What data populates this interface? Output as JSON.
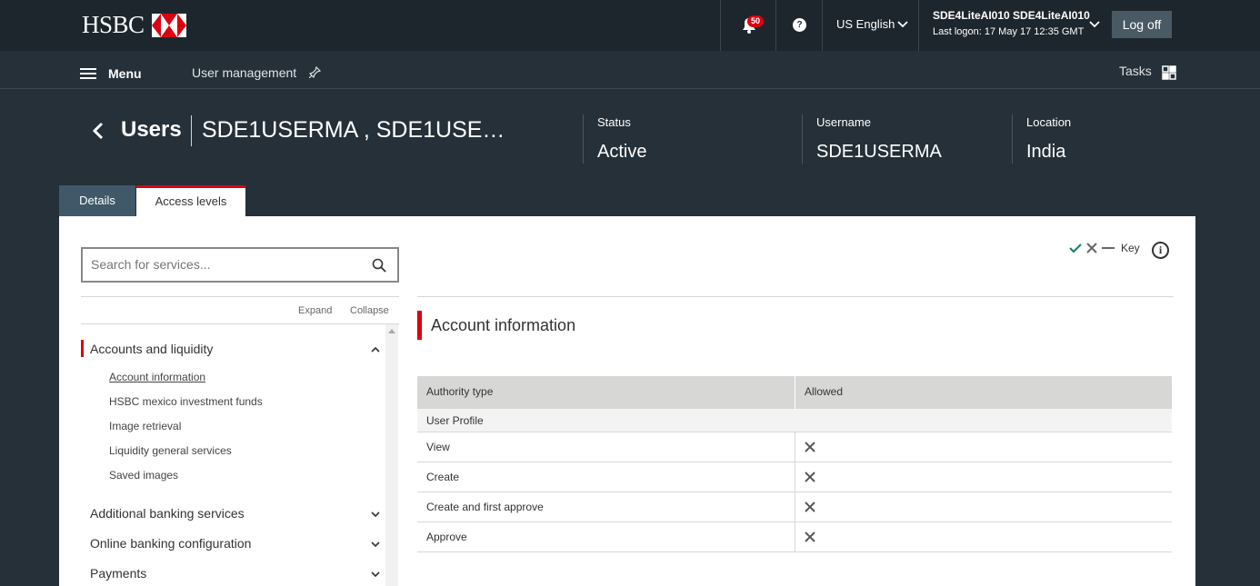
{
  "brand": {
    "name": "HSBC"
  },
  "topbar": {
    "notifications_count": "50",
    "help_icon": "?",
    "language": "US English",
    "user_name": "SDE4LiteAI010 SDE4LiteAI010",
    "last_logon": "Last logon: 17 May 17 12:35 GMT",
    "logoff_label": "Log off"
  },
  "nav": {
    "menu_label": "Menu",
    "current_page": "User management",
    "tasks_label": "Tasks"
  },
  "header": {
    "section": "Users",
    "record_name": "SDE1USERMA , SDE1USE…",
    "status_label": "Status",
    "status_value": "Active",
    "username_label": "Username",
    "username_value": "SDE1USERMA",
    "location_label": "Location",
    "location_value": "India"
  },
  "tabs": [
    {
      "label": "Details",
      "active": false
    },
    {
      "label": "Access levels",
      "active": true
    }
  ],
  "search": {
    "placeholder": "Search for services..."
  },
  "tree_controls": {
    "expand": "Expand",
    "collapse": "Collapse"
  },
  "tree": {
    "categories": [
      {
        "label": "Accounts and liquidity",
        "expanded": true,
        "items": [
          "Account information",
          "HSBC mexico investment funds",
          "Image retrieval",
          "Liquidity general services",
          "Saved images"
        ]
      },
      {
        "label": "Additional banking services",
        "expanded": false
      },
      {
        "label": "Online banking configuration",
        "expanded": false
      },
      {
        "label": "Payments",
        "expanded": false
      }
    ]
  },
  "key": {
    "label": "Key"
  },
  "section": {
    "title": "Account information",
    "table": {
      "headers": [
        "Authority type",
        "Allowed"
      ],
      "group": "User Profile",
      "rows": [
        {
          "authority": "View",
          "allowed": false
        },
        {
          "authority": "Create",
          "allowed": false
        },
        {
          "authority": "Create and first approve",
          "allowed": false
        },
        {
          "authority": "Approve",
          "allowed": false
        }
      ]
    }
  },
  "colors": {
    "brand_red": "#db0011",
    "topbar_bg": "#1d262c",
    "page_bg": "#253038",
    "tab_inactive": "#405867",
    "check_green": "#0b7f6d"
  }
}
